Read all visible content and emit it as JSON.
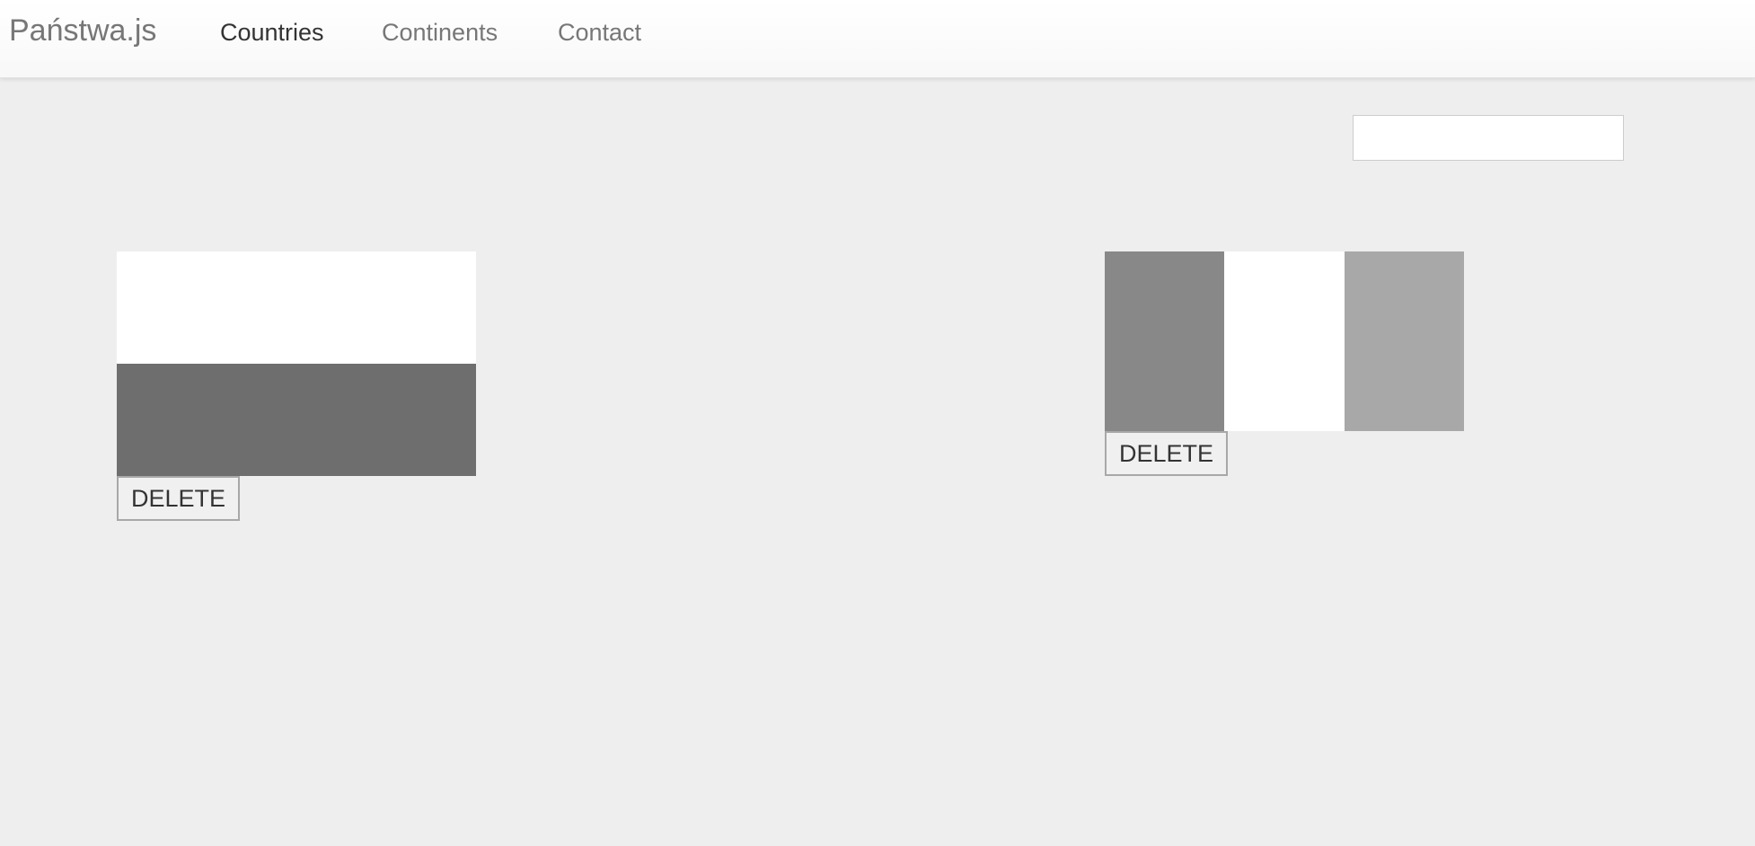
{
  "navbar": {
    "brand": "Państwa.js",
    "links": [
      {
        "label": "Countries",
        "active": true
      },
      {
        "label": "Continents",
        "active": false
      },
      {
        "label": "Contact",
        "active": false
      }
    ]
  },
  "search": {
    "value": "",
    "placeholder": ""
  },
  "countries": [
    {
      "flag_orientation": "horizontal",
      "flag_colors": [
        "#ffffff",
        "#6e6e6e"
      ],
      "delete_label": "DELETE"
    },
    {
      "flag_orientation": "vertical",
      "flag_colors": [
        "#888888",
        "#ffffff",
        "#a8a8a8"
      ],
      "delete_label": "DELETE"
    }
  ]
}
